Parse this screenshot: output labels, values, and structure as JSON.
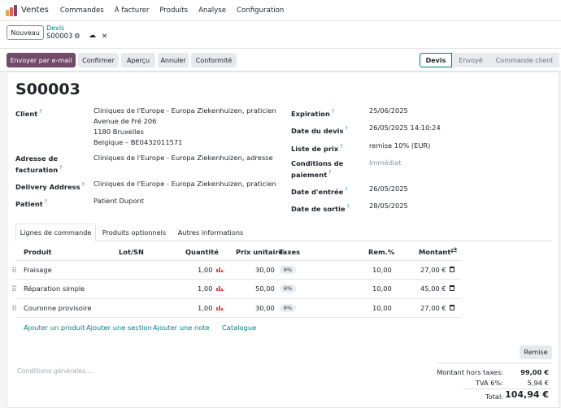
{
  "topnav": {
    "app_title": "Ventes",
    "menu": [
      "Commandes",
      "À facturer",
      "Produits",
      "Analyse",
      "Configuration"
    ]
  },
  "control": {
    "new_label": "Nouveau",
    "breadcrumb_parent": "Devis",
    "breadcrumb_current": "S00003",
    "icons": [
      "gear-icon",
      "cloud-upload-icon",
      "close-icon"
    ]
  },
  "actions": {
    "send_email": "Envoyer par e-mail",
    "confirm": "Confirmer",
    "preview": "Aperçu",
    "cancel": "Annuler",
    "compliance": "Conformité"
  },
  "status": [
    "Devis",
    "Envoyé",
    "Commande client"
  ],
  "record": {
    "name": "S00003",
    "client_label": "Client",
    "client_lines": [
      "Cliniques de l'Europe - Europa Ziekenhuizen, praticien",
      "Avenue de Fré 206",
      "1180 Bruxelles",
      "Belgique – BE0432011571"
    ],
    "billing_label_1": "Adresse de",
    "billing_label_2": "facturation",
    "billing_value": "Cliniques de l'Europe - Europa Ziekenhuizen, adresse",
    "delivery_label": "Delivery Address",
    "delivery_value": "Cliniques de l'Europe - Europa Ziekenhuizen, praticien",
    "patient_label": "Patient",
    "patient_value": "Patient Dupont",
    "expiration_label": "Expiration",
    "expiration_value": "25/06/2025",
    "quote_date_label": "Date du devis",
    "quote_date_value": "26/05/2025 14:10:24",
    "pricelist_label": "Liste de prix",
    "pricelist_value": "remise 10% (EUR)",
    "payment_label_1": "Conditions de",
    "payment_label_2": "paiement",
    "payment_value": "Immédiat",
    "entry_date_label": "Date d'entrée",
    "entry_date_value": "26/05/2025",
    "exit_date_label": "Date de sortie",
    "exit_date_value": "28/05/2025"
  },
  "tabs": [
    "Lignes de commande",
    "Produits optionnels",
    "Autres informations"
  ],
  "table": {
    "headers": {
      "product": "Produit",
      "lot": "Lot/SN",
      "qty": "Quantité",
      "price": "Prix unitaire",
      "taxes": "Taxes",
      "discount": "Rem.%",
      "amount": "Montant"
    },
    "rows": [
      {
        "product": "Fraisage",
        "qty": "1,00",
        "price": "30,00",
        "tax": "6%",
        "discount": "10,00",
        "amount": "27,00 €"
      },
      {
        "product": "Réparation simple",
        "qty": "1,00",
        "price": "50,00",
        "tax": "6%",
        "discount": "10,00",
        "amount": "45,00 €"
      },
      {
        "product": "Couronne provisoire",
        "qty": "1,00",
        "price": "30,00",
        "tax": "6%",
        "discount": "10,00",
        "amount": "27,00 €"
      }
    ],
    "add_product": "Ajouter un produit",
    "add_section": "Ajouter une section",
    "add_note": "Ajouter une note",
    "catalog": "Catalogue"
  },
  "footer": {
    "discount_button": "Remise",
    "terms_placeholder": "Conditions générales...",
    "untaxed_label": "Montant hors taxes:",
    "untaxed_value": "99,00 €",
    "tva_label": "TVA 6%:",
    "tva_value": "5,94 €",
    "total_label": "Total:",
    "total_value": "104,94 €"
  },
  "colors": {
    "primary": "#714b67",
    "accent": "#017e84",
    "chart_icon": "#d9534f"
  }
}
